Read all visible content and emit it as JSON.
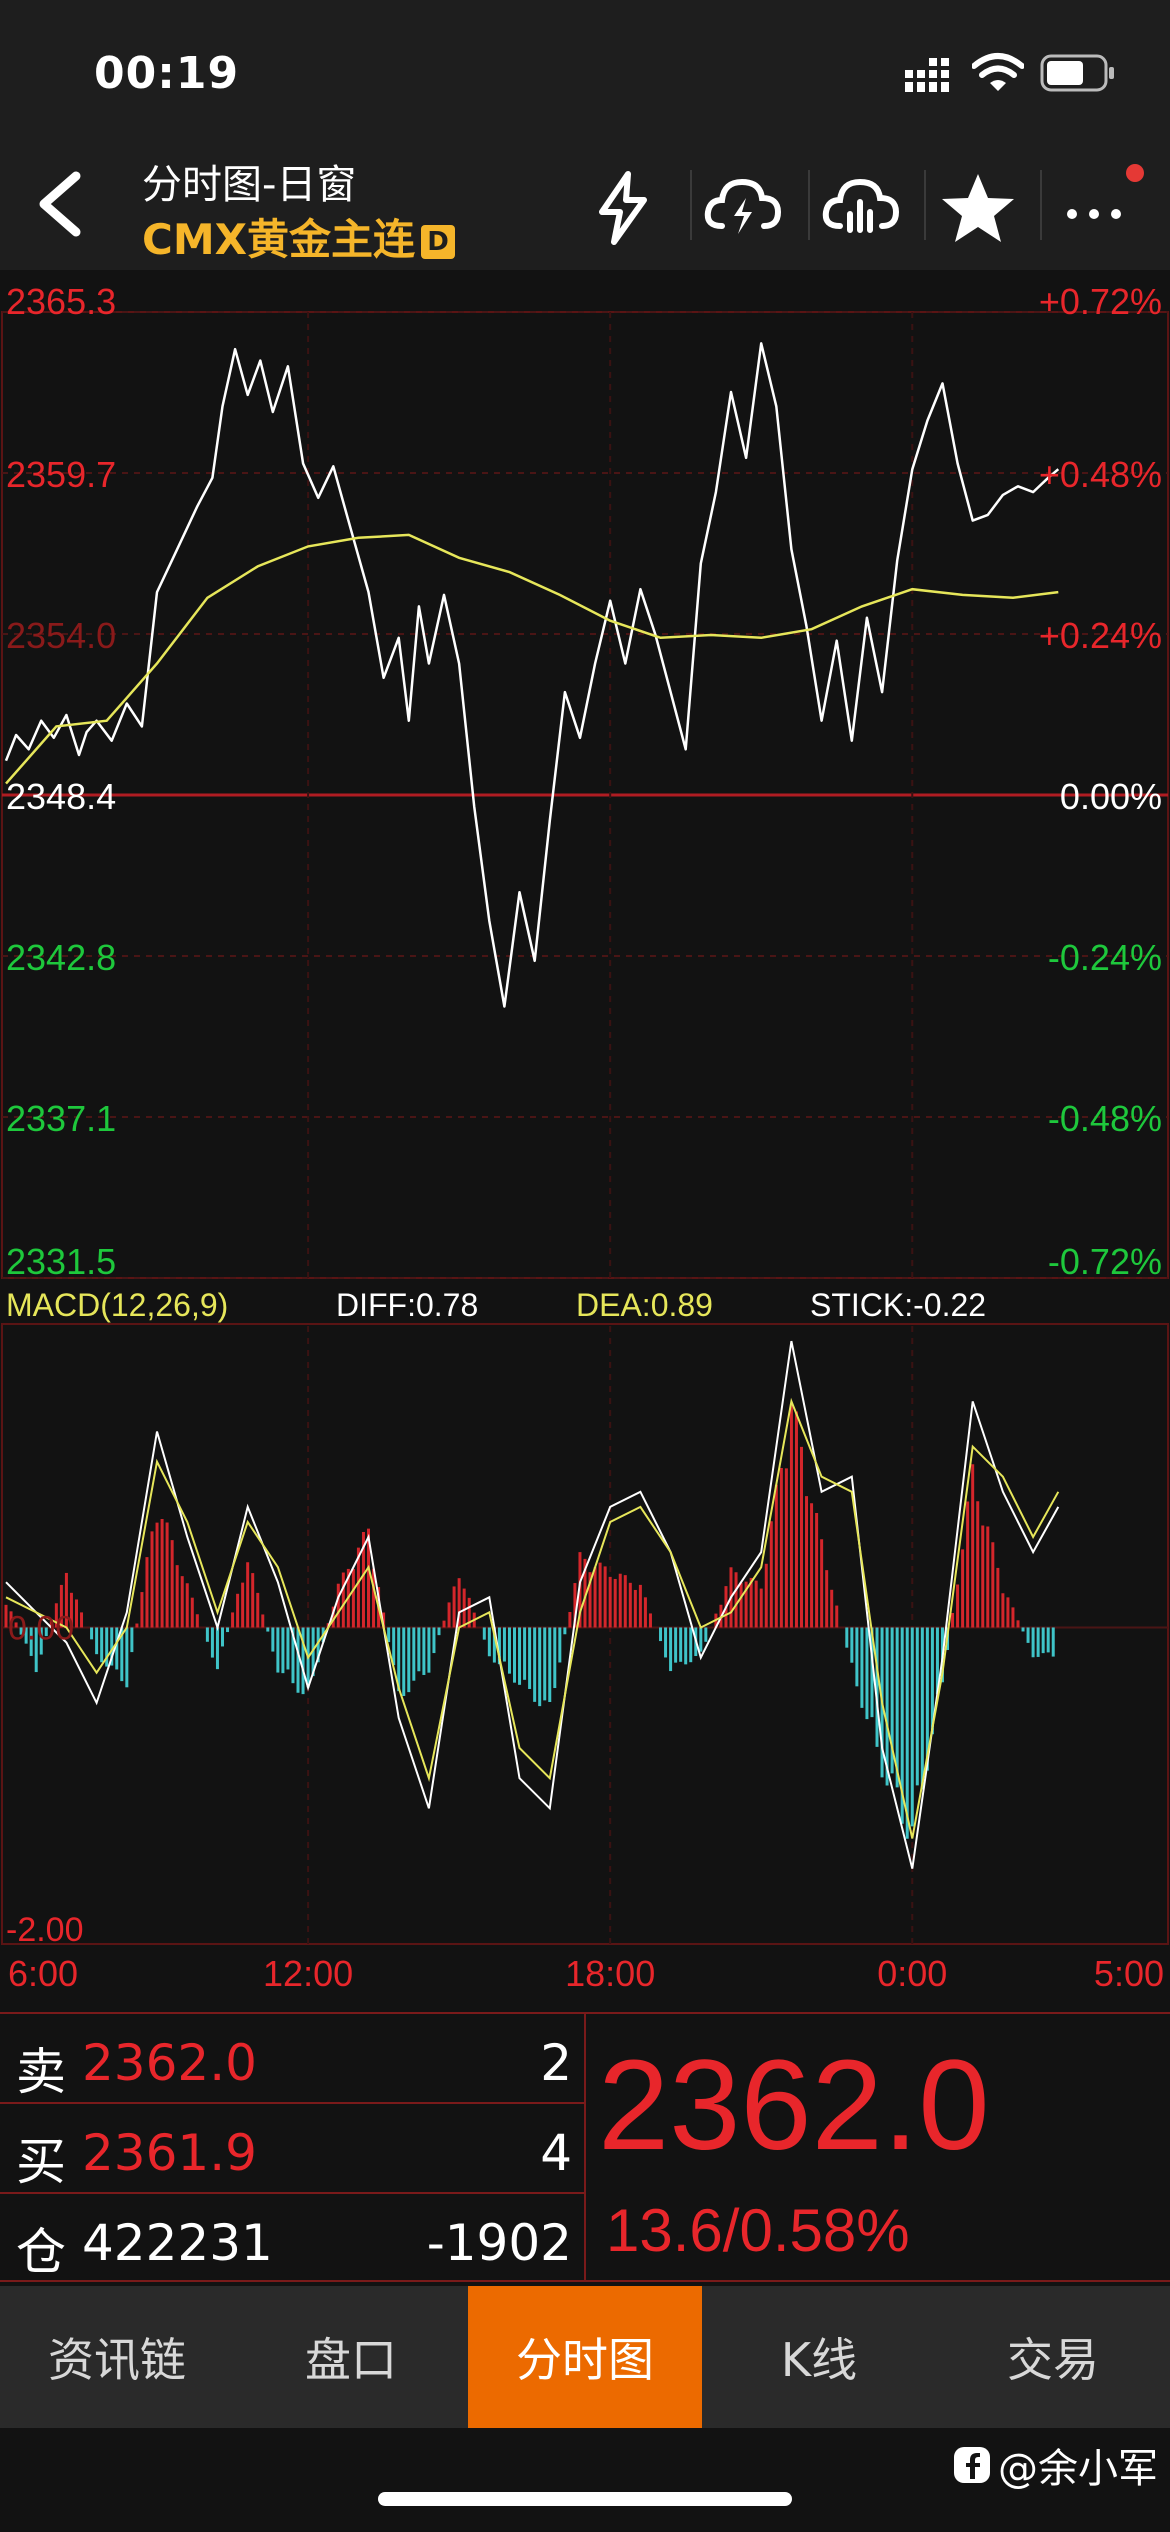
{
  "status_bar": {
    "time": "00:19"
  },
  "header": {
    "title": "分时图-日窗",
    "instrument": "CMX黄金主连",
    "badge": "D",
    "icons": [
      "lightning-icon",
      "cloud-lightning-icon",
      "cloud-chart-icon",
      "star-icon",
      "more-icon"
    ]
  },
  "chart_data": {
    "type": "line",
    "price_axis": {
      "left_labels": [
        "2365.3",
        "2359.7",
        "2354.0",
        "2348.4",
        "2342.8",
        "2337.1",
        "2331.5"
      ],
      "right_labels": [
        "+0.72%",
        "+0.48%",
        "+0.24%",
        "0.00%",
        "-0.24%",
        "-0.48%",
        "-0.72%"
      ],
      "ylim": [
        2331.5,
        2365.3
      ],
      "base": 2348.4
    },
    "time_axis": {
      "labels": [
        "6:00",
        "12:00",
        "18:00",
        "0:00",
        "5:00"
      ]
    },
    "price_series": {
      "name": "price",
      "x": [
        0,
        0.2,
        0.45,
        0.7,
        0.95,
        1.2,
        1.45,
        1.6,
        1.8,
        2.1,
        2.4,
        2.7,
        3.0,
        3.4,
        3.8,
        4.1,
        4.3,
        4.55,
        4.8,
        5.05,
        5.3,
        5.6,
        5.9,
        6.2,
        6.5,
        6.8,
        7.2,
        7.5,
        7.8,
        8.0,
        8.2,
        8.4,
        8.7,
        9.0,
        9.3,
        9.6,
        9.9,
        10.2,
        10.5,
        10.8,
        11.1,
        11.4,
        11.7,
        12.0,
        12.3,
        12.6,
        12.9,
        13.2,
        13.5,
        13.8,
        14.1,
        14.4,
        14.7,
        15.0,
        15.3,
        15.6,
        15.9,
        16.2,
        16.5,
        16.8,
        17.1,
        17.4,
        17.7,
        18.0,
        18.3,
        18.6,
        18.9,
        19.2,
        19.5,
        19.8,
        20.1,
        20.4,
        20.7,
        20.9
      ],
      "values": [
        2349.6,
        2350.5,
        2350.0,
        2351.0,
        2350.4,
        2351.2,
        2349.8,
        2350.6,
        2351.0,
        2350.3,
        2351.6,
        2350.8,
        2355.5,
        2357.0,
        2358.5,
        2359.5,
        2362.0,
        2364.0,
        2362.4,
        2363.6,
        2361.8,
        2363.4,
        2360.0,
        2358.8,
        2359.9,
        2358.0,
        2355.5,
        2352.5,
        2353.9,
        2351.0,
        2355.0,
        2353.0,
        2355.4,
        2353.0,
        2348.0,
        2344.0,
        2341.0,
        2345.0,
        2342.6,
        2347.5,
        2352.0,
        2350.4,
        2353.0,
        2355.2,
        2353.0,
        2355.6,
        2354.0,
        2352.0,
        2350.0,
        2356.5,
        2359.0,
        2362.5,
        2360.2,
        2364.2,
        2362.0,
        2357.0,
        2354.3,
        2351.0,
        2353.8,
        2350.3,
        2354.6,
        2352.0,
        2356.6,
        2359.8,
        2361.5,
        2362.8,
        2360.0,
        2358.0,
        2358.2,
        2358.9,
        2359.2,
        2359.0,
        2359.5,
        2359.8
      ]
    },
    "avg_series": {
      "name": "avg",
      "x": [
        0,
        1.0,
        2.0,
        3.0,
        4.0,
        5.0,
        6.0,
        7.0,
        8.0,
        9.0,
        10.0,
        11.0,
        12.0,
        13.0,
        14.0,
        15.0,
        16.0,
        17.0,
        18.0,
        19.0,
        20.0,
        20.9
      ],
      "values": [
        2348.8,
        2350.8,
        2351.0,
        2353.0,
        2355.3,
        2356.4,
        2357.1,
        2357.4,
        2357.5,
        2356.7,
        2356.2,
        2355.4,
        2354.5,
        2353.9,
        2354.0,
        2353.9,
        2354.2,
        2355.0,
        2355.6,
        2355.4,
        2355.3,
        2355.5
      ]
    },
    "macd": {
      "title": "MACD(12,26,9)",
      "diff_label": "DIFF:0.78",
      "dea_label": "DEA:0.89",
      "stick_label": "STICK:-0.22",
      "zero_label": "0.00",
      "min_label": "-2.00",
      "ylim": [
        -2.1,
        2.0
      ],
      "x": [
        0,
        0.6,
        1.2,
        1.8,
        2.4,
        3.0,
        3.6,
        4.2,
        4.8,
        5.4,
        6.0,
        6.6,
        7.2,
        7.8,
        8.4,
        9.0,
        9.6,
        10.2,
        10.8,
        11.4,
        12.0,
        12.6,
        13.2,
        13.8,
        14.4,
        15.0,
        15.6,
        16.2,
        16.8,
        17.4,
        18.0,
        18.6,
        19.2,
        19.8,
        20.4,
        20.9
      ],
      "diff": [
        0.3,
        0.1,
        -0.1,
        -0.5,
        0.1,
        1.3,
        0.6,
        0.0,
        0.8,
        0.3,
        -0.4,
        0.2,
        0.6,
        -0.6,
        -1.2,
        0.1,
        0.2,
        -1.0,
        -1.2,
        0.3,
        0.8,
        0.9,
        0.5,
        -0.2,
        0.2,
        0.5,
        1.9,
        0.9,
        1.0,
        -0.8,
        -1.6,
        -0.2,
        1.5,
        0.9,
        0.5,
        0.8
      ],
      "dea": [
        0.2,
        0.1,
        0.0,
        -0.3,
        0.0,
        1.1,
        0.7,
        0.1,
        0.7,
        0.4,
        -0.2,
        0.1,
        0.4,
        -0.4,
        -1.0,
        0.0,
        0.1,
        -0.8,
        -1.0,
        0.1,
        0.7,
        0.8,
        0.5,
        0.0,
        0.1,
        0.4,
        1.5,
        1.0,
        0.9,
        -0.5,
        -1.4,
        -0.3,
        1.2,
        1.0,
        0.6,
        0.9
      ],
      "stick": [
        0.2,
        -0.3,
        0.4,
        -0.2,
        -0.4,
        0.9,
        0.3,
        -0.3,
        0.5,
        -0.3,
        -0.5,
        0.3,
        0.7,
        -0.5,
        -0.3,
        0.4,
        -0.2,
        -0.4,
        -0.6,
        0.5,
        0.4,
        0.3,
        -0.3,
        -0.2,
        0.4,
        0.3,
        1.6,
        0.6,
        -0.3,
        -1.0,
        -1.5,
        -0.4,
        1.1,
        0.3,
        -0.2,
        -0.2
      ]
    }
  },
  "quote": {
    "sell_label": "卖",
    "sell_price": "2362.0",
    "sell_qty": "2",
    "buy_label": "买",
    "buy_price": "2361.9",
    "buy_qty": "4",
    "oi_label": "仓",
    "oi_value": "422231",
    "oi_change": "-1902",
    "last_price": "2362.0",
    "change": "13.6/0.58%"
  },
  "tabs": [
    {
      "label": "资讯链",
      "active": false
    },
    {
      "label": "盘口",
      "active": false
    },
    {
      "label": "分时图",
      "active": true
    },
    {
      "label": "K线",
      "active": false
    },
    {
      "label": "交易",
      "active": false
    }
  ],
  "watermark": "@余小军",
  "colors": {
    "up": "#e8262b",
    "down": "#1ec83c",
    "accent": "#ec6a00",
    "avg": "#e6e65a",
    "stick_down": "#3fc4c8",
    "gold": "#f5b52a"
  }
}
